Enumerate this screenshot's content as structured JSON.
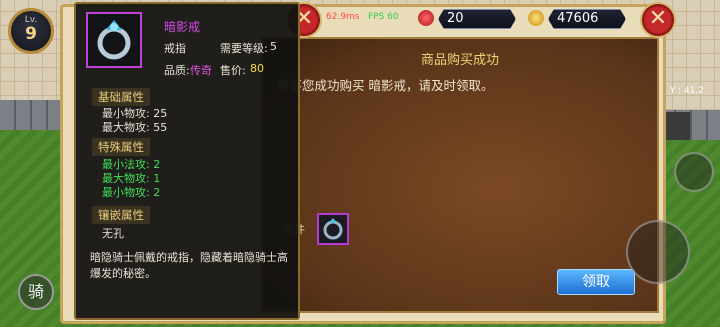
{
  "hud": {
    "level_label": "Lv.",
    "level_value": "9",
    "signal_text": "62.9ms",
    "fps_text": "FPS 60",
    "gems": "20",
    "gold": "47606",
    "coord_text": "Y : 41.2",
    "ride_label": "骑"
  },
  "dialog": {
    "title": "商品购买成功",
    "message": "恭喜您成功购买 暗影戒，请及时领取。",
    "attachment_label": "附件",
    "claim_button": "领取"
  },
  "item": {
    "name": "暗影戒",
    "type": "戒指",
    "required_level_label": "需要等级:",
    "required_level": "5",
    "quality_label": "品质:",
    "quality": "传奇",
    "price_label": "售价:",
    "price": "80",
    "base_section": "基础属性",
    "base_stats": [
      "最小物攻: 25",
      "最大物攻: 55"
    ],
    "special_section": "特殊属性",
    "special_stats": [
      "最小法攻: 2",
      "最大物攻: 1",
      "最小物攻: 2"
    ],
    "socket_section": "镶嵌属性",
    "socket_value": "无孔",
    "description": "暗隐骑士佩戴的戒指，隐藏着暗隐骑士高爆发的秘密。"
  },
  "colors": {
    "legendary": "#e055e6",
    "green_stat": "#3fe05a",
    "price": "#f2d94a"
  },
  "icons": [
    "close-icon",
    "gem-icon",
    "gold-coin-icon",
    "ring-icon"
  ]
}
